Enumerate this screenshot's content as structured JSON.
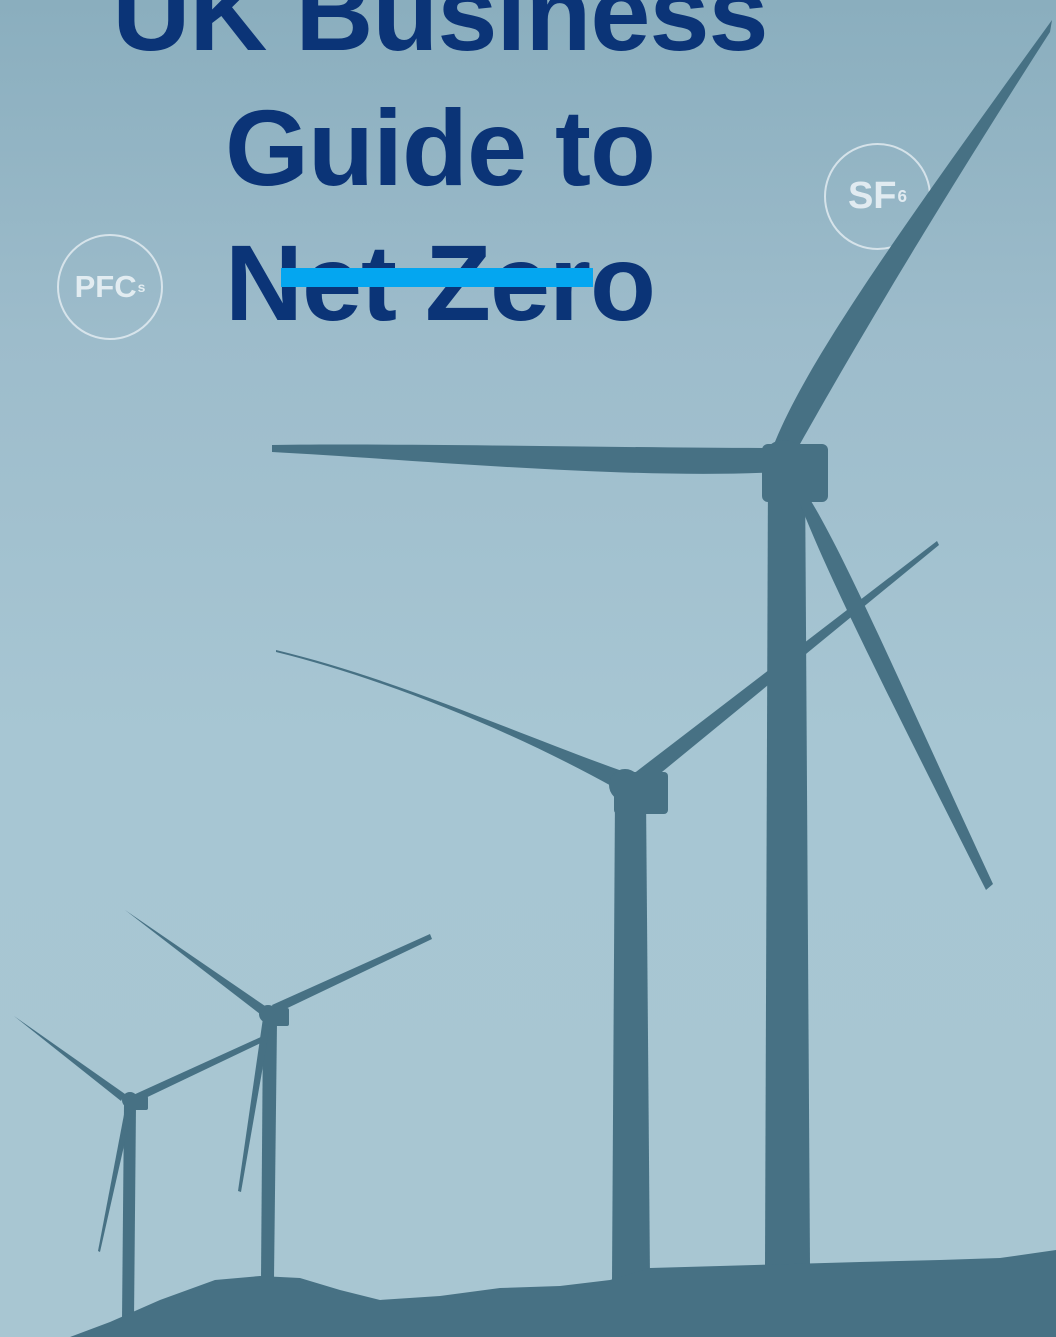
{
  "title": {
    "line1": "UK Business Guide to",
    "line2": "Net Zero"
  },
  "badges": {
    "pfcs": {
      "main": "PFC",
      "sub": "s"
    },
    "sf6": {
      "main": "SF",
      "sub": "6"
    }
  },
  "colors": {
    "title": "#0b3477",
    "accent": "#04a6f0",
    "turbine": "#477184",
    "sky": "#a7c6d3"
  }
}
